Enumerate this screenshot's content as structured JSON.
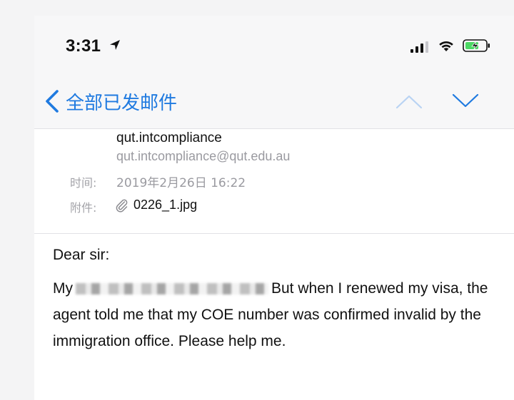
{
  "status_bar": {
    "time": "3:31",
    "icons": [
      "location-arrow-icon",
      "cellular-signal-icon",
      "wifi-icon",
      "battery-charging-icon"
    ]
  },
  "nav": {
    "back_label": "全部已发邮件",
    "back_icon": "chevron-left-icon",
    "up_icon": "chevron-up-icon",
    "down_icon": "chevron-down-icon",
    "accent_color": "#1f7ae0"
  },
  "header": {
    "sender_name": "qut.intcompliance",
    "sender_email": "qut.intcompliance@qut.edu.au",
    "time_label": "时间:",
    "time_value": "2019年2月26日 16:22",
    "attachment_label": "附件:",
    "attachment_name": "0226_1.jpg",
    "attachment_icon": "paperclip-icon"
  },
  "body": {
    "greeting": "Dear sir:",
    "para_start": "My",
    "para_rest": "But when I renewed my visa, the agent told me that my COE number was confirmed invalid by the immigration office. Please help me."
  }
}
